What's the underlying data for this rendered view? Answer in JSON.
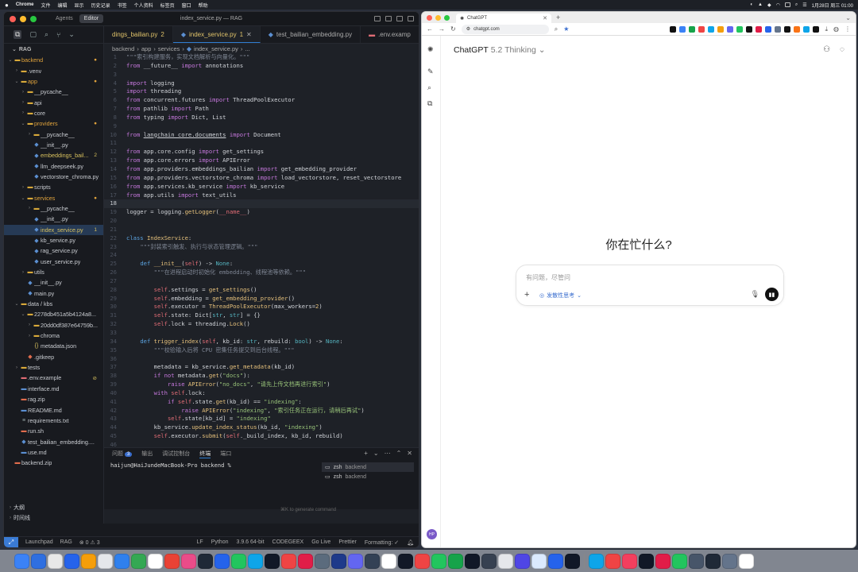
{
  "menubar": {
    "app": "Chrome",
    "items": [
      "文件",
      "编辑",
      "显示",
      "历史记录",
      "书签",
      "个人资料",
      "标签页",
      "窗口",
      "帮助"
    ],
    "clock": "1月28日 周三 01:00"
  },
  "vscode": {
    "mode_tabs": [
      "Agents",
      "Editor"
    ],
    "window_title": "index_service.py — RAG",
    "tabs": [
      {
        "label": "dings_bailian.py",
        "badge": "2"
      },
      {
        "label": "index_service.py",
        "badge": "1"
      },
      {
        "label": "test_bailian_embedding.py",
        "badge": ""
      },
      {
        "label": ".env.examp",
        "badge": ""
      }
    ],
    "explorer_title": "RAG",
    "tree": [
      {
        "label": "backend",
        "depth": 0,
        "kind": "folder",
        "open": true,
        "color": "orange",
        "badge": "●"
      },
      {
        "label": ".venv",
        "depth": 1,
        "kind": "folder",
        "open": false,
        "color": "",
        "badge": ""
      },
      {
        "label": "app",
        "depth": 1,
        "kind": "folder",
        "open": true,
        "color": "orange",
        "badge": "●"
      },
      {
        "label": "__pycache__",
        "depth": 2,
        "kind": "folder",
        "open": false,
        "color": "",
        "badge": ""
      },
      {
        "label": "api",
        "depth": 2,
        "kind": "folder",
        "open": false,
        "color": "",
        "badge": ""
      },
      {
        "label": "core",
        "depth": 2,
        "kind": "folder",
        "open": false,
        "color": "",
        "badge": ""
      },
      {
        "label": "providers",
        "depth": 2,
        "kind": "folder",
        "open": true,
        "color": "orange",
        "badge": "●"
      },
      {
        "label": "__pycache__",
        "depth": 3,
        "kind": "folder",
        "open": false,
        "color": "",
        "badge": ""
      },
      {
        "label": "__init__.py",
        "depth": 3,
        "kind": "py",
        "open": false,
        "color": "",
        "badge": ""
      },
      {
        "label": "embeddings_bail...",
        "depth": 3,
        "kind": "py",
        "open": false,
        "color": "yellow",
        "badge": "2"
      },
      {
        "label": "llm_deepseek.py",
        "depth": 3,
        "kind": "py",
        "open": false,
        "color": "",
        "badge": ""
      },
      {
        "label": "vectorstore_chroma.py",
        "depth": 3,
        "kind": "py",
        "open": false,
        "color": "",
        "badge": ""
      },
      {
        "label": "scripts",
        "depth": 2,
        "kind": "folder",
        "open": false,
        "color": "",
        "badge": ""
      },
      {
        "label": "services",
        "depth": 2,
        "kind": "folder",
        "open": true,
        "color": "orange",
        "badge": "●"
      },
      {
        "label": "__pycache__",
        "depth": 3,
        "kind": "folder",
        "open": false,
        "color": "",
        "badge": ""
      },
      {
        "label": "__init__.py",
        "depth": 3,
        "kind": "py",
        "open": false,
        "color": "",
        "badge": ""
      },
      {
        "label": "index_service.py",
        "depth": 3,
        "kind": "py",
        "open": false,
        "color": "yellow",
        "badge": "1",
        "selected": true
      },
      {
        "label": "kb_service.py",
        "depth": 3,
        "kind": "py",
        "open": false,
        "color": "",
        "badge": ""
      },
      {
        "label": "rag_service.py",
        "depth": 3,
        "kind": "py",
        "open": false,
        "color": "",
        "badge": ""
      },
      {
        "label": "user_service.py",
        "depth": 3,
        "kind": "py",
        "open": false,
        "color": "",
        "badge": ""
      },
      {
        "label": "utils",
        "depth": 2,
        "kind": "folder",
        "open": false,
        "color": "",
        "badge": ""
      },
      {
        "label": "__init__.py",
        "depth": 2,
        "kind": "py",
        "open": false,
        "color": "",
        "badge": ""
      },
      {
        "label": "main.py",
        "depth": 2,
        "kind": "py",
        "open": false,
        "color": "",
        "badge": ""
      },
      {
        "label": "data / kbs",
        "depth": 1,
        "kind": "folder",
        "open": true,
        "color": "",
        "badge": ""
      },
      {
        "label": "2278db451a5b4124a8...",
        "depth": 2,
        "kind": "folder",
        "open": true,
        "color": "",
        "badge": ""
      },
      {
        "label": "20dd0df387e64759b...",
        "depth": 3,
        "kind": "folder",
        "open": false,
        "color": "",
        "badge": ""
      },
      {
        "label": "chroma",
        "depth": 3,
        "kind": "folder",
        "open": false,
        "color": "",
        "badge": ""
      },
      {
        "label": "metadata.json",
        "depth": 3,
        "kind": "json",
        "open": false,
        "color": "",
        "badge": ""
      },
      {
        "label": ".gitkeep",
        "depth": 2,
        "kind": "git",
        "open": false,
        "color": "",
        "badge": ""
      },
      {
        "label": "tests",
        "depth": 1,
        "kind": "folder",
        "open": false,
        "color": "",
        "badge": ""
      },
      {
        "label": ".env.example",
        "depth": 1,
        "kind": "env",
        "open": false,
        "color": "",
        "badge": "⊘"
      },
      {
        "label": "interface.md",
        "depth": 1,
        "kind": "md",
        "open": false,
        "color": "",
        "badge": ""
      },
      {
        "label": "rag.zip",
        "depth": 1,
        "kind": "zip",
        "open": false,
        "color": "",
        "badge": ""
      },
      {
        "label": "README.md",
        "depth": 1,
        "kind": "md",
        "open": false,
        "color": "",
        "badge": ""
      },
      {
        "label": "requirements.txt",
        "depth": 1,
        "kind": "txt",
        "open": false,
        "color": "",
        "badge": ""
      },
      {
        "label": "run.sh",
        "depth": 1,
        "kind": "sh",
        "open": false,
        "color": "",
        "badge": ""
      },
      {
        "label": "test_bailian_embedding....",
        "depth": 1,
        "kind": "py",
        "open": false,
        "color": "",
        "badge": ""
      },
      {
        "label": "use.md",
        "depth": 1,
        "kind": "md",
        "open": false,
        "color": "",
        "badge": ""
      },
      {
        "label": "backend.zip",
        "depth": 0,
        "kind": "zip",
        "open": false,
        "color": "",
        "badge": ""
      }
    ],
    "sidebar_bottom": [
      "大纲",
      "时间线"
    ],
    "breadcrumb": [
      "backend",
      "app",
      "services",
      "index_service.py",
      "..."
    ],
    "current_line": 18,
    "code": [
      {
        "n": "1",
        "html": "<span class=\"cm\">\"\"\"索引构建服务，实现文档解析与向量化。\"\"\"</span>"
      },
      {
        "n": "2",
        "html": "<span class=\"kw\">from</span> __future__ <span class=\"kw\">import</span> annotations"
      },
      {
        "n": "3",
        "html": ""
      },
      {
        "n": "4",
        "html": "<span class=\"kw\">import</span> logging"
      },
      {
        "n": "5",
        "html": "<span class=\"kw\">import</span> threading"
      },
      {
        "n": "6",
        "html": "<span class=\"kw\">from</span> concurrent.futures <span class=\"kw\">import</span> ThreadPoolExecutor"
      },
      {
        "n": "7",
        "html": "<span class=\"kw\">from</span> pathlib <span class=\"kw\">import</span> Path"
      },
      {
        "n": "8",
        "html": "<span class=\"kw\">from</span> typing <span class=\"kw\">import</span> Dict, List"
      },
      {
        "n": "9",
        "html": ""
      },
      {
        "n": "10",
        "html": "<span class=\"kw\">from</span> <u>langchain_core.documents</u> <span class=\"kw\">import</span> Document"
      },
      {
        "n": "11",
        "html": ""
      },
      {
        "n": "12",
        "html": "<span class=\"kw\">from</span> app.core.config <span class=\"kw\">import</span> get_settings"
      },
      {
        "n": "13",
        "html": "<span class=\"kw\">from</span> app.core.errors <span class=\"kw\">import</span> APIError"
      },
      {
        "n": "14",
        "html": "<span class=\"kw\">from</span> app.providers.embeddings_bailian <span class=\"kw\">import</span> get_embedding_provider"
      },
      {
        "n": "15",
        "html": "<span class=\"kw\">from</span> app.providers.vectorstore_chroma <span class=\"kw\">import</span> load_vectorstore, reset_vectorstore"
      },
      {
        "n": "16",
        "html": "<span class=\"kw\">from</span> app.services.kb_service <span class=\"kw\">import</span> kb_service"
      },
      {
        "n": "17",
        "html": "<span class=\"kw\">from</span> app.utils <span class=\"kw\">import</span> text_utils"
      },
      {
        "n": "18",
        "html": ""
      },
      {
        "n": "19",
        "html": "logger = logging.<span class=\"fn\">getLogger</span>(<span class=\"self\">__name__</span>)"
      },
      {
        "n": "20",
        "html": ""
      },
      {
        "n": "21",
        "html": ""
      },
      {
        "n": "22",
        "html": "<span class=\"kwb\">class</span> <span class=\"cls-n\">IndexService</span>:"
      },
      {
        "n": "23",
        "html": "    <span class=\"cm\">\"\"\"封装索引触发、执行与状态管理逻辑。\"\"\"</span>"
      },
      {
        "n": "24",
        "html": ""
      },
      {
        "n": "25",
        "html": "    <span class=\"kwb\">def</span> <span class=\"fn\">__init__</span>(<span class=\"self\">self</span>) -> <span class=\"typ\">None</span>:"
      },
      {
        "n": "26",
        "html": "        <span class=\"cm\">\"\"\"在进程启动时初始化 embedding、线程池等依赖。\"\"\"</span>"
      },
      {
        "n": "27",
        "html": ""
      },
      {
        "n": "28",
        "html": "        <span class=\"self\">self</span>.settings = <span class=\"fn\">get_settings</span>()"
      },
      {
        "n": "29",
        "html": "        <span class=\"self\">self</span>.embedding = <span class=\"fn\">get_embedding_provider</span>()"
      },
      {
        "n": "30",
        "html": "        <span class=\"self\">self</span>.executor = <span class=\"fn\">ThreadPoolExecutor</span>(max_workers=<span class=\"fn\">2</span>)"
      },
      {
        "n": "31",
        "html": "        <span class=\"self\">self</span>.state: Dict[<span class=\"typ\">str</span>, <span class=\"typ\">str</span>] = {}"
      },
      {
        "n": "32",
        "html": "        <span class=\"self\">self</span>.lock = threading.<span class=\"fn\">Lock</span>()"
      },
      {
        "n": "33",
        "html": ""
      },
      {
        "n": "34",
        "html": "    <span class=\"kwb\">def</span> <span class=\"fn\">trigger_index</span>(<span class=\"self\">self</span>, kb_id: <span class=\"typ\">str</span>, rebuild: <span class=\"typ\">bool</span>) -> <span class=\"typ\">None</span>:"
      },
      {
        "n": "35",
        "html": "        <span class=\"cm\">\"\"\"校验输入后将 CPU 密集任务提交到后台线程。\"\"\"</span>"
      },
      {
        "n": "36",
        "html": ""
      },
      {
        "n": "37",
        "html": "        metadata = kb_service.<span class=\"fn\">get_metadata</span>(kb_id)"
      },
      {
        "n": "38",
        "html": "        <span class=\"kw\">if not</span> metadata.<span class=\"fn\">get</span>(<span class=\"str\">\"docs\"</span>):"
      },
      {
        "n": "39",
        "html": "            <span class=\"kw\">raise</span> <span class=\"fn\">APIError</span>(<span class=\"str\">\"no_docs\"</span>, <span class=\"str\">\"请先上传文档再进行索引\"</span>)"
      },
      {
        "n": "40",
        "html": "        <span class=\"kw\">with</span> <span class=\"self\">self</span>.lock:"
      },
      {
        "n": "41",
        "html": "            <span class=\"kw\">if</span> <span class=\"self\">self</span>.state.<span class=\"fn\">get</span>(kb_id) == <span class=\"str\">\"indexing\"</span>:"
      },
      {
        "n": "42",
        "html": "                <span class=\"kw\">raise</span> <span class=\"fn\">APIError</span>(<span class=\"str\">\"indexing\"</span>, <span class=\"str\">\"索引任务正在运行，请稍后再试\"</span>)"
      },
      {
        "n": "43",
        "html": "            <span class=\"self\">self</span>.state[kb_id] = <span class=\"str\">\"indexing\"</span>"
      },
      {
        "n": "44",
        "html": "        kb_service.<span class=\"fn\">update_index_status</span>(kb_id, <span class=\"str\">\"indexing\"</span>)"
      },
      {
        "n": "45",
        "html": "        <span class=\"self\">self</span>.executor.<span class=\"fn\">submit</span>(<span class=\"self\">self</span>._build_index, kb_id, rebuild)"
      },
      {
        "n": "46",
        "html": ""
      },
      {
        "n": "47",
        "html": "    <span class=\"kwb\">def</span> <span class=\"fn\">_build_index</span>(<span class=\"self\">self</span>, kb_id: <span class=\"typ\">str</span>, rebuild: <span class=\"typ\">bool</span>) -> <span class=\"typ\">None</span>:"
      },
      {
        "n": "48",
        "html": "        <span class=\"cm\">\"\"\"真正执行解析、切分、写入向量库等慢任务。\"\"\"</span>"
      }
    ],
    "panel_tabs": [
      "问题",
      "输出",
      "调试控制台",
      "终端",
      "端口"
    ],
    "problems_count": "3",
    "terminal_prompt": "haijun@HaiJundeMacBook-Pro backend %",
    "terminal_sessions": [
      {
        "name": "zsh",
        "cwd": "backend"
      },
      {
        "name": "zsh",
        "cwd": "backend"
      }
    ],
    "ghost_hint": "⌘K to generate command",
    "status": {
      "launchpad": "Launchpad",
      "workspace": "RAG",
      "diagnostics": "⊗ 0 ⚠ 3",
      "eol": "LF",
      "language": "Python",
      "interpreter": "3.9.6 64-bit",
      "codegeex": "CODEGEEX",
      "golive": "Go Live",
      "prettier": "Prettier",
      "formatting": "Formatting: ✓"
    }
  },
  "chrome": {
    "tab_title": "ChatGPT",
    "url": "chatgpt.com",
    "app_name": "ChatGPT",
    "model": "5.2 Thinking",
    "greeting": "你在忙什么?",
    "composer_placeholder": "有问题，尽管问",
    "think_label": "发散性思考",
    "avatar_initials": "HP"
  },
  "dock_colors": [
    "#3b82f6",
    "#2f6fe0",
    "#e8e8e8",
    "#2563eb",
    "#f59e0b",
    "#e5e7eb",
    "#2f80ed",
    "#34a853",
    "#ffffff",
    "#e94235",
    "#ea4c89",
    "#1f2937",
    "#2563eb",
    "#22c55e",
    "#0ea5e9",
    "#111827",
    "#ef4444",
    "#e11d48",
    "#5b6b7d",
    "#1e3a8a",
    "#6366f1",
    "#334155",
    "#ffffff",
    "#111827",
    "#ef4444",
    "#22c55e",
    "#16a34a",
    "#111827",
    "#374151",
    "#e5e7eb",
    "#4f46e5",
    "#dbeafe",
    "#2563eb",
    "#111827",
    "#0ea5e9",
    "#ef4444",
    "#f43f5e",
    "#111827",
    "#e11d48",
    "#22c55e",
    "#475569",
    "#1f2937",
    "#64748b",
    "#ffffff"
  ]
}
